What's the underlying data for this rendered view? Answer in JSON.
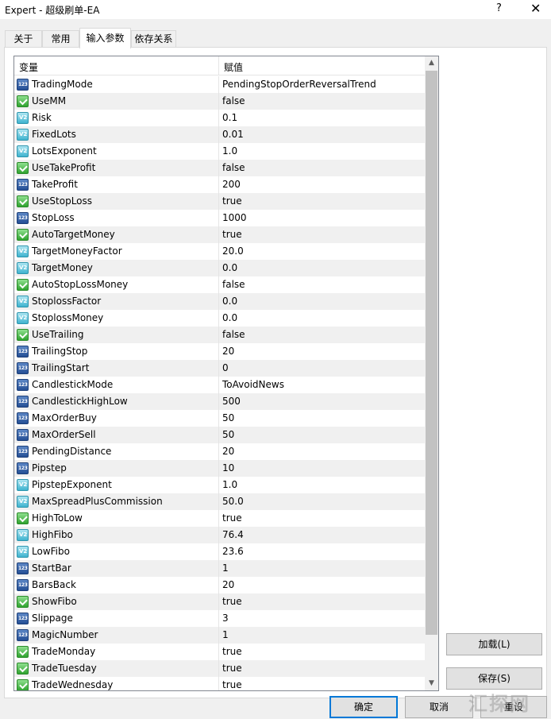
{
  "window": {
    "title": "Expert - 超级刷单-EA",
    "help_glyph": "?",
    "close_glyph": "✕"
  },
  "tabs": [
    {
      "label": "关于"
    },
    {
      "label": "常用"
    },
    {
      "label": "输入参数",
      "active": true
    },
    {
      "label": "依存关系"
    }
  ],
  "list": {
    "col_variable": "变量",
    "col_value": "赋值",
    "rows": [
      {
        "name": "TradingMode",
        "value": "PendingStopOrderReversalTrend",
        "icon": "enum"
      },
      {
        "name": "UseMM",
        "value": "false",
        "icon": "bool"
      },
      {
        "name": "Risk",
        "value": "0.1",
        "icon": "dbl"
      },
      {
        "name": "FixedLots",
        "value": "0.01",
        "icon": "dbl"
      },
      {
        "name": "LotsExponent",
        "value": "1.0",
        "icon": "dbl"
      },
      {
        "name": "UseTakeProfit",
        "value": "false",
        "icon": "bool"
      },
      {
        "name": "TakeProfit",
        "value": "200",
        "icon": "int"
      },
      {
        "name": "UseStopLoss",
        "value": "true",
        "icon": "bool"
      },
      {
        "name": "StopLoss",
        "value": "1000",
        "icon": "int"
      },
      {
        "name": "AutoTargetMoney",
        "value": "true",
        "icon": "bool"
      },
      {
        "name": "TargetMoneyFactor",
        "value": "20.0",
        "icon": "dbl"
      },
      {
        "name": "TargetMoney",
        "value": "0.0",
        "icon": "dbl"
      },
      {
        "name": "AutoStopLossMoney",
        "value": "false",
        "icon": "bool"
      },
      {
        "name": "StoplossFactor",
        "value": "0.0",
        "icon": "dbl"
      },
      {
        "name": "StoplossMoney",
        "value": "0.0",
        "icon": "dbl"
      },
      {
        "name": "UseTrailing",
        "value": "false",
        "icon": "bool"
      },
      {
        "name": "TrailingStop",
        "value": "20",
        "icon": "int"
      },
      {
        "name": "TrailingStart",
        "value": "0",
        "icon": "int"
      },
      {
        "name": "CandlestickMode",
        "value": "ToAvoidNews",
        "icon": "enum"
      },
      {
        "name": "CandlestickHighLow",
        "value": "500",
        "icon": "int"
      },
      {
        "name": "MaxOrderBuy",
        "value": "50",
        "icon": "int"
      },
      {
        "name": "MaxOrderSell",
        "value": "50",
        "icon": "int"
      },
      {
        "name": "PendingDistance",
        "value": "20",
        "icon": "int"
      },
      {
        "name": "Pipstep",
        "value": "10",
        "icon": "int"
      },
      {
        "name": "PipstepExponent",
        "value": "1.0",
        "icon": "dbl"
      },
      {
        "name": "MaxSpreadPlusCommission",
        "value": "50.0",
        "icon": "dbl"
      },
      {
        "name": "HighToLow",
        "value": "true",
        "icon": "bool"
      },
      {
        "name": "HighFibo",
        "value": "76.4",
        "icon": "dbl"
      },
      {
        "name": "LowFibo",
        "value": "23.6",
        "icon": "dbl"
      },
      {
        "name": "StartBar",
        "value": "1",
        "icon": "int"
      },
      {
        "name": "BarsBack",
        "value": "20",
        "icon": "int"
      },
      {
        "name": "ShowFibo",
        "value": "true",
        "icon": "bool"
      },
      {
        "name": "Slippage",
        "value": "3",
        "icon": "int"
      },
      {
        "name": "MagicNumber",
        "value": "1",
        "icon": "int"
      },
      {
        "name": "TradeMonday",
        "value": "true",
        "icon": "bool"
      },
      {
        "name": "TradeTuesday",
        "value": "true",
        "icon": "bool"
      },
      {
        "name": "TradeWednesday",
        "value": "true",
        "icon": "bool"
      }
    ]
  },
  "buttons": {
    "load": "加载(L)",
    "save": "保存(S)",
    "ok": "确定",
    "cancel": "取消",
    "reset": "重设"
  },
  "watermark": "汇探网"
}
